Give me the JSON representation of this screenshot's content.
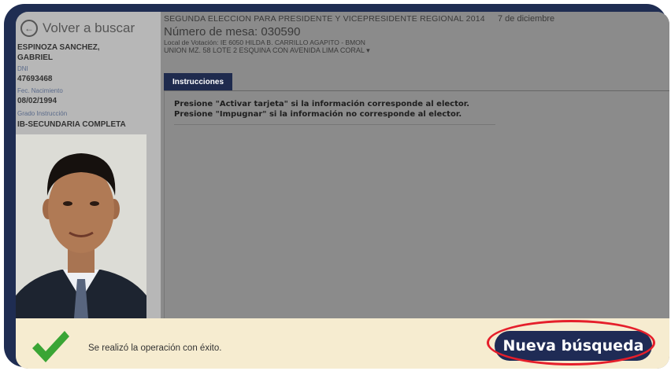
{
  "sidebar": {
    "back_label": "Volver a buscar",
    "lines": [
      {
        "text": "ESPINOZA SANCHEZ,",
        "kind": "val"
      },
      {
        "text": "GABRIEL",
        "kind": "val"
      },
      {
        "text": "DNI",
        "kind": "lbl"
      },
      {
        "text": "47693468",
        "kind": "val"
      },
      {
        "text": "Fec. Nacimiento",
        "kind": "lbl"
      },
      {
        "text": "08/02/1994",
        "kind": "val"
      },
      {
        "text": "Grado Instrucción",
        "kind": "lbl"
      },
      {
        "text": "IB-SECUNDARIA COMPLETA",
        "kind": "val"
      }
    ]
  },
  "header": {
    "election": "SEGUNDA ELECCION PARA PRESIDENTE Y VICEPRESIDENTE REGIONAL 2014",
    "date": "7 de diciembre",
    "mesa": "Número de mesa: 030590",
    "local": "Local de Votación: IE 6050 HILDA B. CARRILLO AGAPITO - BMON",
    "address": "UNION MZ. 58 LOTE 2 ESQUINA CON AVENIDA LIMA CORAL"
  },
  "tab": {
    "label": "Instrucciones"
  },
  "instructions": {
    "line1": "Presione \"Activar tarjeta\" si la información corresponde al elector.",
    "line2": "Presione \"Impugnar\" si la información no corresponde al elector."
  },
  "footer": {
    "message": "Se realizó la operación con éxito.",
    "button_label": "Nueva búsqueda"
  },
  "colors": {
    "navy": "#1f2b55",
    "success_green": "#3aa535",
    "highlight_red": "#e51f2b",
    "footer_bg": "#f6ecd0"
  }
}
